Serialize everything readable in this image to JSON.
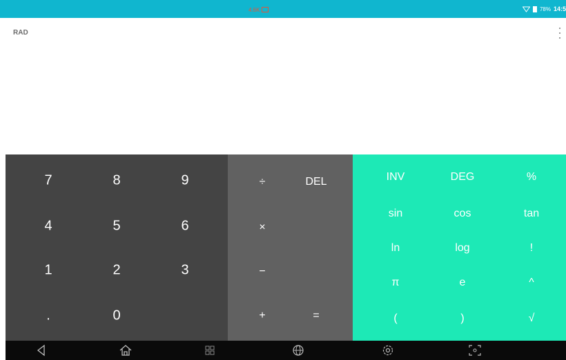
{
  "status_bar": {
    "network": "4.6K",
    "battery_percent": "78%",
    "time": "14:5"
  },
  "display": {
    "angle_mode": "RAD"
  },
  "number_pad": {
    "keys": [
      "7",
      "8",
      "9",
      "4",
      "5",
      "6",
      "1",
      "2",
      "3",
      ".",
      "0"
    ]
  },
  "operator_pad": {
    "divide": "÷",
    "delete": "DEL",
    "multiply": "×",
    "minus": "−",
    "plus": "+",
    "equals": "="
  },
  "scientific_pad": {
    "keys": [
      "INV",
      "DEG",
      "%",
      "sin",
      "cos",
      "tan",
      "ln",
      "log",
      "!",
      "π",
      "e",
      "^",
      "(",
      ")",
      "√"
    ]
  },
  "nav_bar": {
    "icons": [
      "back-icon",
      "home-icon",
      "recent-apps-icon",
      "globe-icon",
      "settings-icon",
      "screenshot-icon"
    ]
  },
  "colors": {
    "status_bar": "#10b6cf",
    "number_pad": "#444444",
    "operator_pad": "#616161",
    "scientific_pad": "#1de9b6",
    "nav_bar": "#0a0a0a"
  }
}
